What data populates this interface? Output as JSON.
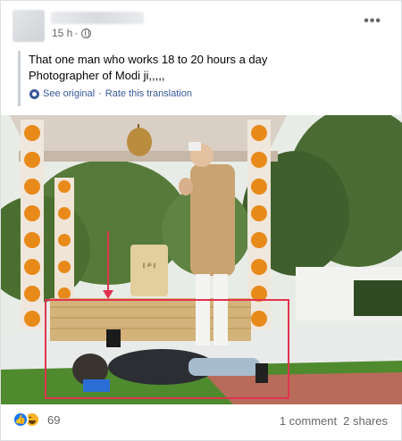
{
  "post": {
    "time": "15 h",
    "separator": "·",
    "more_label": "•••",
    "text_line1": "That one man who works 18 to 20 hours a day",
    "text_line2": "Photographer of Modi ji,,,,,",
    "see_original": "See original",
    "dot": "·",
    "rate_translation": "Rate this translation"
  },
  "photo": {
    "plaque_text": "|| ॐ ||"
  },
  "footer": {
    "reaction_count": "69",
    "comments": "1 comment",
    "shares": "2 shares"
  },
  "colors": {
    "link": "#385898",
    "muted": "#65676b",
    "like": "#1877f2",
    "highlight_box": "#e0344f"
  }
}
